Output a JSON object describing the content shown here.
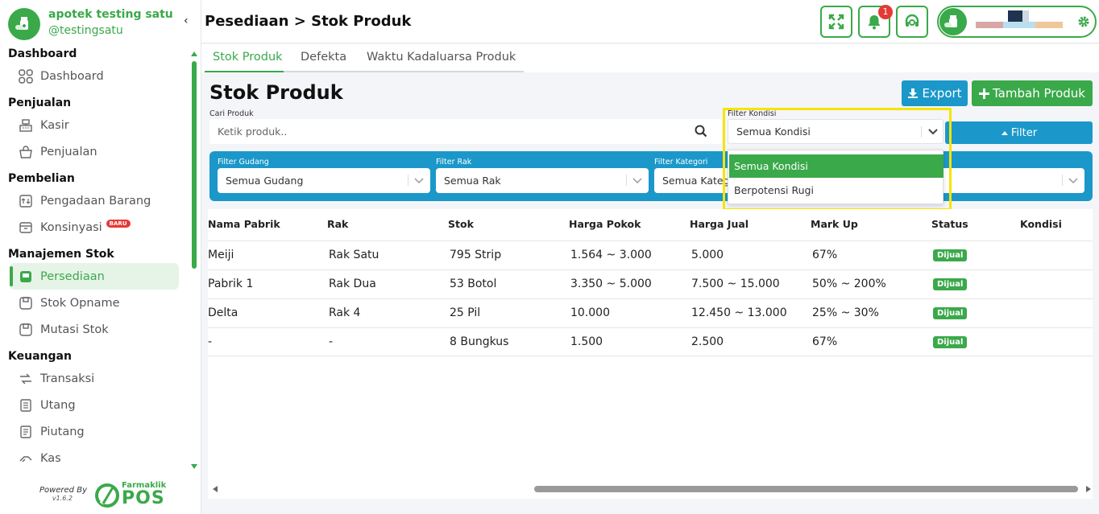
{
  "app": {
    "brand_name": "apotek testing satu",
    "brand_user": "@testingsatu",
    "collapse_glyph": "‹",
    "page_title": "Pesediaan > Stok Produk",
    "notification_count": "1"
  },
  "sidebar": {
    "sections": [
      {
        "title": "Dashboard",
        "items": [
          {
            "label": "Dashboard",
            "icon": "dashboard-icon"
          }
        ]
      },
      {
        "title": "Penjualan",
        "items": [
          {
            "label": "Kasir",
            "icon": "cash-register-icon"
          },
          {
            "label": "Penjualan",
            "icon": "basket-icon"
          }
        ]
      },
      {
        "title": "Pembelian",
        "items": [
          {
            "label": "Pengadaan Barang",
            "icon": "procurement-icon"
          },
          {
            "label": "Konsinyasi",
            "icon": "box-icon",
            "badge": "BARU"
          }
        ]
      },
      {
        "title": "Manajemen Stok",
        "items": [
          {
            "label": "Persediaan",
            "icon": "inventory-icon",
            "active": true
          },
          {
            "label": "Stok Opname",
            "icon": "stock-opname-icon"
          },
          {
            "label": "Mutasi Stok",
            "icon": "mutation-icon"
          }
        ]
      },
      {
        "title": "Keuangan",
        "items": [
          {
            "label": "Transaksi",
            "icon": "transaction-icon"
          },
          {
            "label": "Utang",
            "icon": "debt-icon"
          },
          {
            "label": "Piutang",
            "icon": "receivable-icon"
          },
          {
            "label": "Kas",
            "icon": "cash-icon"
          }
        ]
      }
    ],
    "powered_by": "Powered By",
    "version": "v1.6.2",
    "logo_small": "Farmaklik",
    "logo_big": "POS"
  },
  "tabs": [
    {
      "label": "Stok Produk",
      "active": true
    },
    {
      "label": "Defekta",
      "active": false
    },
    {
      "label": "Waktu Kadaluarsa Produk",
      "active": false
    }
  ],
  "main": {
    "title": "Stok Produk",
    "export_label": "Export",
    "tambah_label": "Tambah Produk",
    "search_label": "Cari Produk",
    "search_placeholder": "Ketik produk..",
    "kondisi_label": "Filter Kondisi",
    "kondisi_value": "Semua Kondisi",
    "filter_label": "Filter",
    "filters": {
      "gudang_label": "Filter Gudang",
      "gudang_value": "Semua Gudang",
      "rak_label": "Filter Rak",
      "rak_value": "Semua Rak",
      "kategori_label": "Filter Kategori",
      "kategori_value": "Semua Kategori"
    },
    "kondisi_options": [
      "Semua Kondisi",
      "Berpotensi Rugi"
    ]
  },
  "table": {
    "headers": [
      "Nama Pabrik",
      "Rak",
      "Stok",
      "Harga Pokok",
      "Harga Jual",
      "Mark Up",
      "Status",
      "Kondisi"
    ],
    "rows": [
      [
        "Meiji",
        "Rak Satu",
        "795 Strip",
        "1.564 ~ 3.000",
        "5.000",
        "67%",
        "Dijual",
        ""
      ],
      [
        "Pabrik 1",
        "Rak Dua",
        "53 Botol",
        "3.350 ~ 5.000",
        "7.500 ~ 15.000",
        "50% ~ 200%",
        "Dijual",
        ""
      ],
      [
        "Delta",
        "Rak 4",
        "25 Pil",
        "10.000",
        "12.450 ~ 13.000",
        "25% ~ 30%",
        "Dijual",
        ""
      ],
      [
        "-",
        "-",
        "8 Bungkus",
        "1.500",
        "2.500",
        "67%",
        "Dijual",
        ""
      ]
    ]
  },
  "colors": {
    "primary_green": "#3aa94a",
    "primary_blue": "#1b98c9",
    "highlight": "#f5e500",
    "badge_red": "#e53935"
  }
}
